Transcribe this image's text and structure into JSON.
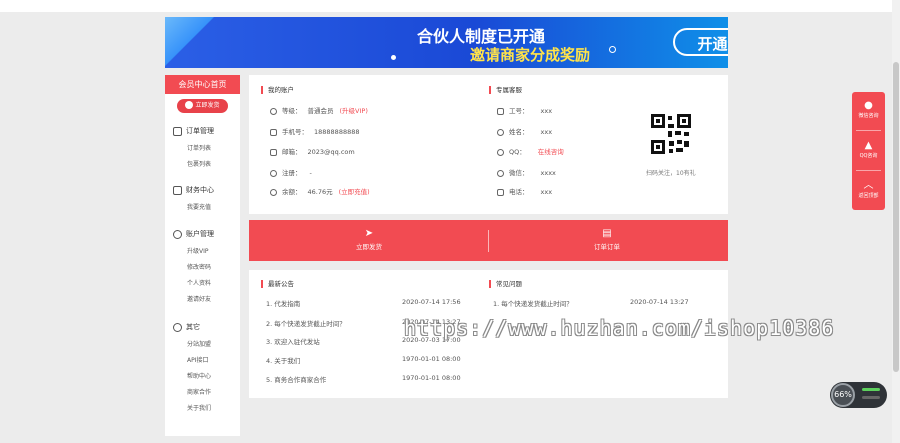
{
  "banner": {
    "title": "合伙人制度已开通",
    "subtitle": "邀请商家分成奖励",
    "button": "开通合伙人"
  },
  "sidebar": {
    "header": "会员中心首页",
    "publish_btn": "立即发货",
    "groups": [
      {
        "label": "订单管理",
        "items": [
          "订单列表",
          "包裹列表"
        ]
      },
      {
        "label": "财务中心",
        "items": [
          "我要充值"
        ]
      },
      {
        "label": "账户管理",
        "items": [
          "升级VIP",
          "修改密码",
          "个人资料",
          "邀请好友"
        ]
      },
      {
        "label": "其它",
        "items": [
          "分站加盟",
          "API接口",
          "帮助中心",
          "商家合作",
          "关于我们"
        ]
      }
    ]
  },
  "account": {
    "title": "我的账户",
    "level_label": "等级：",
    "level_value": "普通会员",
    "level_action": "(升级VIP)",
    "phone_label": "手机号：",
    "phone_value": "18888888888",
    "email_label": "邮箱：",
    "email_value": "2023@qq.com",
    "reg_label": "注册：",
    "reg_value": "-",
    "balance_label": "余额：",
    "balance_value": "46.76元",
    "balance_action": "(立即充值)"
  },
  "service": {
    "title": "专属客服",
    "id_label": "工号：",
    "id_value": "xxx",
    "name_label": "姓名：",
    "name_value": "xxx",
    "qq_label": "QQ：",
    "qq_value": "在线咨询",
    "wechat_label": "微信：",
    "wechat_value": "xxxx",
    "tel_label": "电话：",
    "tel_value": "xxx",
    "qr_caption": "扫码关注，10有礼"
  },
  "actions": {
    "ship": "立即发货",
    "orders": "订单订单"
  },
  "notices": {
    "title": "最新公告",
    "items": [
      {
        "text": "1. 代发指南",
        "date": "2020-07-14 17:56"
      },
      {
        "text": "2. 每个快递发货截止时间？",
        "date": "2020-07-14 13:27"
      },
      {
        "text": "3. 欢迎入驻代发站",
        "date": "2020-07-03 17:00"
      },
      {
        "text": "4. 关于我们",
        "date": "1970-01-01 08:00"
      },
      {
        "text": "5. 商务合作商家合作",
        "date": "1970-01-01 08:00"
      }
    ]
  },
  "faq": {
    "title": "常见问题",
    "items": [
      {
        "text": "1. 每个快递发货截止时间？",
        "date": "2020-07-14 13:27"
      }
    ]
  },
  "floatbar": {
    "wechat": "微信咨询",
    "qq": "QQ咨询",
    "top": "返回顶部"
  },
  "watermark": "https://www.huzhan.com/ishop10386",
  "speed": {
    "value": "66%"
  }
}
